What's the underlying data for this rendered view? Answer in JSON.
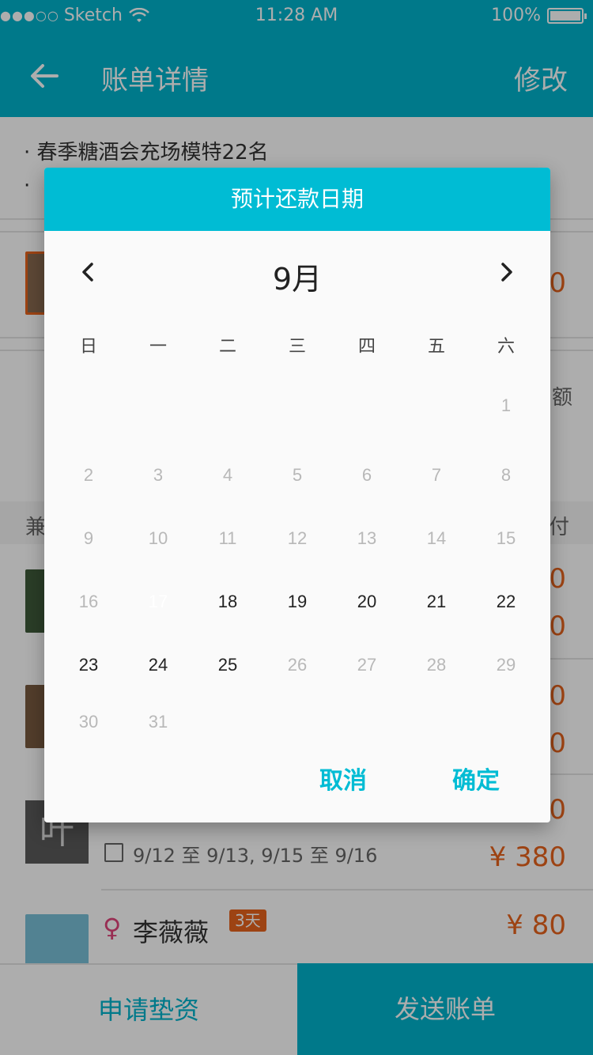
{
  "status_bar": {
    "signal": "●●●○○",
    "carrier": "Sketch",
    "time": "11:28 AM",
    "battery": "100%"
  },
  "nav": {
    "title": "账单详情",
    "edit_label": "修改"
  },
  "background": {
    "bullet_1": "· 春季糖酒会充场模特22名",
    "bullet_2": "·",
    "amount_1": "0",
    "side_label_amount": "额",
    "left_label": "兼",
    "right_label": "付",
    "row_amounts": [
      "0",
      "0",
      "0",
      "0",
      "0"
    ],
    "ye_avatar": "叶",
    "ye_dates": "9/12 至 9/13, 9/15 至 9/16",
    "ye_amount": "¥ 380",
    "female_symbol": "♀",
    "li_name": "李薇薇",
    "li_days": "3天",
    "li_amount": "¥ 80"
  },
  "dialog": {
    "title": "预计还款日期",
    "month": "9月",
    "weekdays": [
      "日",
      "一",
      "二",
      "三",
      "四",
      "五",
      "六"
    ],
    "first_weekday_index": 6,
    "days_in_month": 31,
    "selected_day": 17,
    "enabled_days": [
      17,
      18,
      19,
      20,
      21,
      22,
      23,
      24,
      25
    ],
    "cancel_label": "取消",
    "confirm_label": "确定"
  },
  "bottom": {
    "apply_label": "申请垫资",
    "send_label": "发送账单"
  },
  "colors": {
    "primary": "#00b3cc",
    "dialog_header": "#00bcd4",
    "accent": "#e8641c",
    "female": "#e0457b"
  }
}
